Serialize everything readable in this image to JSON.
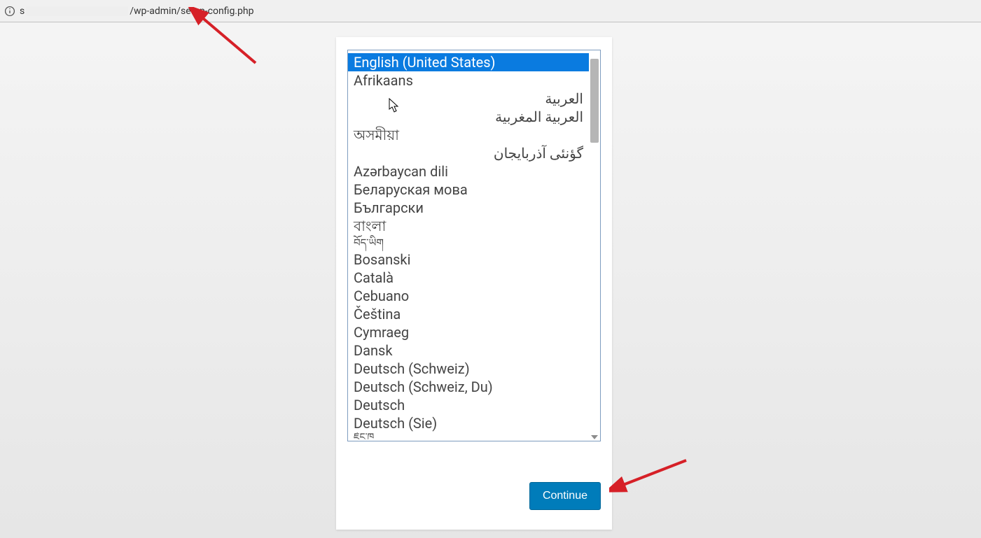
{
  "address": {
    "prefix": "s",
    "suffix": "/wp-admin/setup-config.php"
  },
  "languages": [
    {
      "label": "English (United States)",
      "selected": true
    },
    {
      "label": "Afrikaans"
    },
    {
      "label": "العربية",
      "rtl": true
    },
    {
      "label": "العربية المغربية",
      "rtl": true
    },
    {
      "label": "অসমীয়া"
    },
    {
      "label": "گؤنئی آذربایجان",
      "rtl": true
    },
    {
      "label": "Azərbaycan dili"
    },
    {
      "label": "Беларуская мова"
    },
    {
      "label": "Български"
    },
    {
      "label": "বাংলা"
    },
    {
      "label": "བོད་ཡིག",
      "small": true
    },
    {
      "label": "Bosanski"
    },
    {
      "label": "Català"
    },
    {
      "label": "Cebuano"
    },
    {
      "label": "Čeština"
    },
    {
      "label": "Cymraeg"
    },
    {
      "label": "Dansk"
    },
    {
      "label": "Deutsch (Schweiz)"
    },
    {
      "label": "Deutsch (Schweiz, Du)"
    },
    {
      "label": "Deutsch"
    },
    {
      "label": "Deutsch (Sie)"
    },
    {
      "label": "ཇོང་ཁ",
      "small": true,
      "partial": true
    }
  ],
  "button": {
    "continue_label": "Continue"
  },
  "colors": {
    "selected_bg": "#0a7be0",
    "button_bg": "#007cba",
    "annotation": "#d62027"
  }
}
